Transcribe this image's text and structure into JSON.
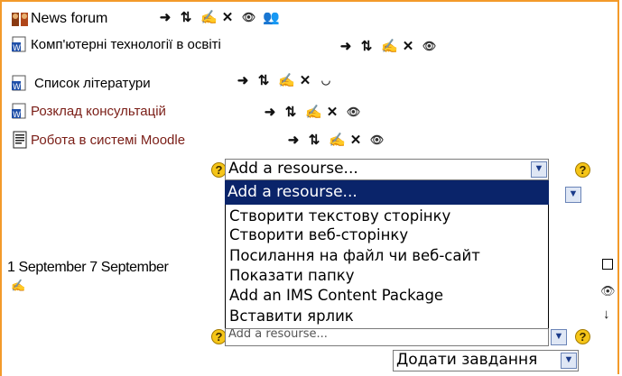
{
  "resources": [
    {
      "title": "News forum",
      "link": false,
      "icon": "forum-icon",
      "actions": [
        "move-right-icon",
        "move-updown-icon",
        "edit-icon",
        "delete-icon",
        "eye-icon",
        "group-mode-icon"
      ]
    },
    {
      "title": "Комп'ютерні технології в освіті",
      "link": false,
      "icon": "word-document-icon",
      "actions": [
        "move-right-icon",
        "move-updown-icon",
        "edit-icon",
        "delete-icon",
        "eye-icon"
      ]
    },
    {
      "title": "Список літератури",
      "link": false,
      "icon": "word-document-icon",
      "actions": [
        "move-right-icon",
        "move-updown-icon",
        "edit-icon",
        "delete-icon",
        "eye-closed-icon"
      ]
    },
    {
      "title": "Розклад консультацій",
      "link": true,
      "icon": "word-document-icon",
      "actions": [
        "move-right-icon",
        "move-updown-icon",
        "edit-icon",
        "delete-icon",
        "eye-icon"
      ]
    },
    {
      "title": "Робота в системі Moodle",
      "link": true,
      "icon": "text-page-icon",
      "actions": [
        "move-right-icon",
        "move-updown-icon",
        "edit-icon",
        "delete-icon",
        "eye-icon"
      ]
    }
  ],
  "add_resource": {
    "selected": "Add a resourse...",
    "options": [
      "Add a resourse...",
      "Створити текстову сторінку",
      "Створити веб-сторінку",
      "Посилання на файл чи веб-сайт",
      "Показати папку",
      "Add an IMS Content Package",
      "Вставити ярлик"
    ]
  },
  "week": {
    "label": "1 September 7 September"
  },
  "add_activity": {
    "selected": "Додати завдання"
  },
  "colors": {
    "frame": "#f39a2a",
    "link": "#7a1d16",
    "highlight": "#0a246a"
  }
}
